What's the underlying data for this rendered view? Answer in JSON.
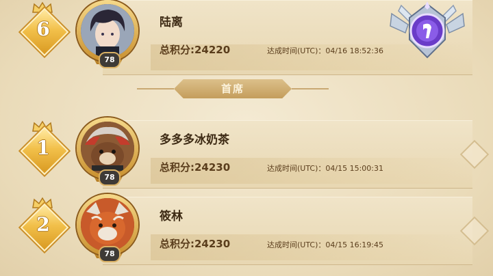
{
  "top_entry": {
    "rank": "6",
    "name": "陆离",
    "level": "78",
    "score": "总积分:24220",
    "achieved": "达成时间(UTC)：04/16 18:52:36"
  },
  "divider": {
    "label": "首席"
  },
  "entries": [
    {
      "rank": "1",
      "name": "多多多冰奶茶",
      "level": "78",
      "score": "总积分:24230",
      "achieved": "达成时间(UTC)：04/15 15:00:31"
    },
    {
      "rank": "2",
      "name": "筱林",
      "level": "78",
      "score": "总积分:24230",
      "achieved": "达成时间(UTC)：04/15 16:19:45"
    }
  ],
  "colors": {
    "gold": "#f2c04a",
    "text_dark": "#3d2a14",
    "emblem_purple": "#6a3cc8"
  },
  "icons": {
    "crown": "crown-icon",
    "emblem": "rank-emblem-icon"
  }
}
